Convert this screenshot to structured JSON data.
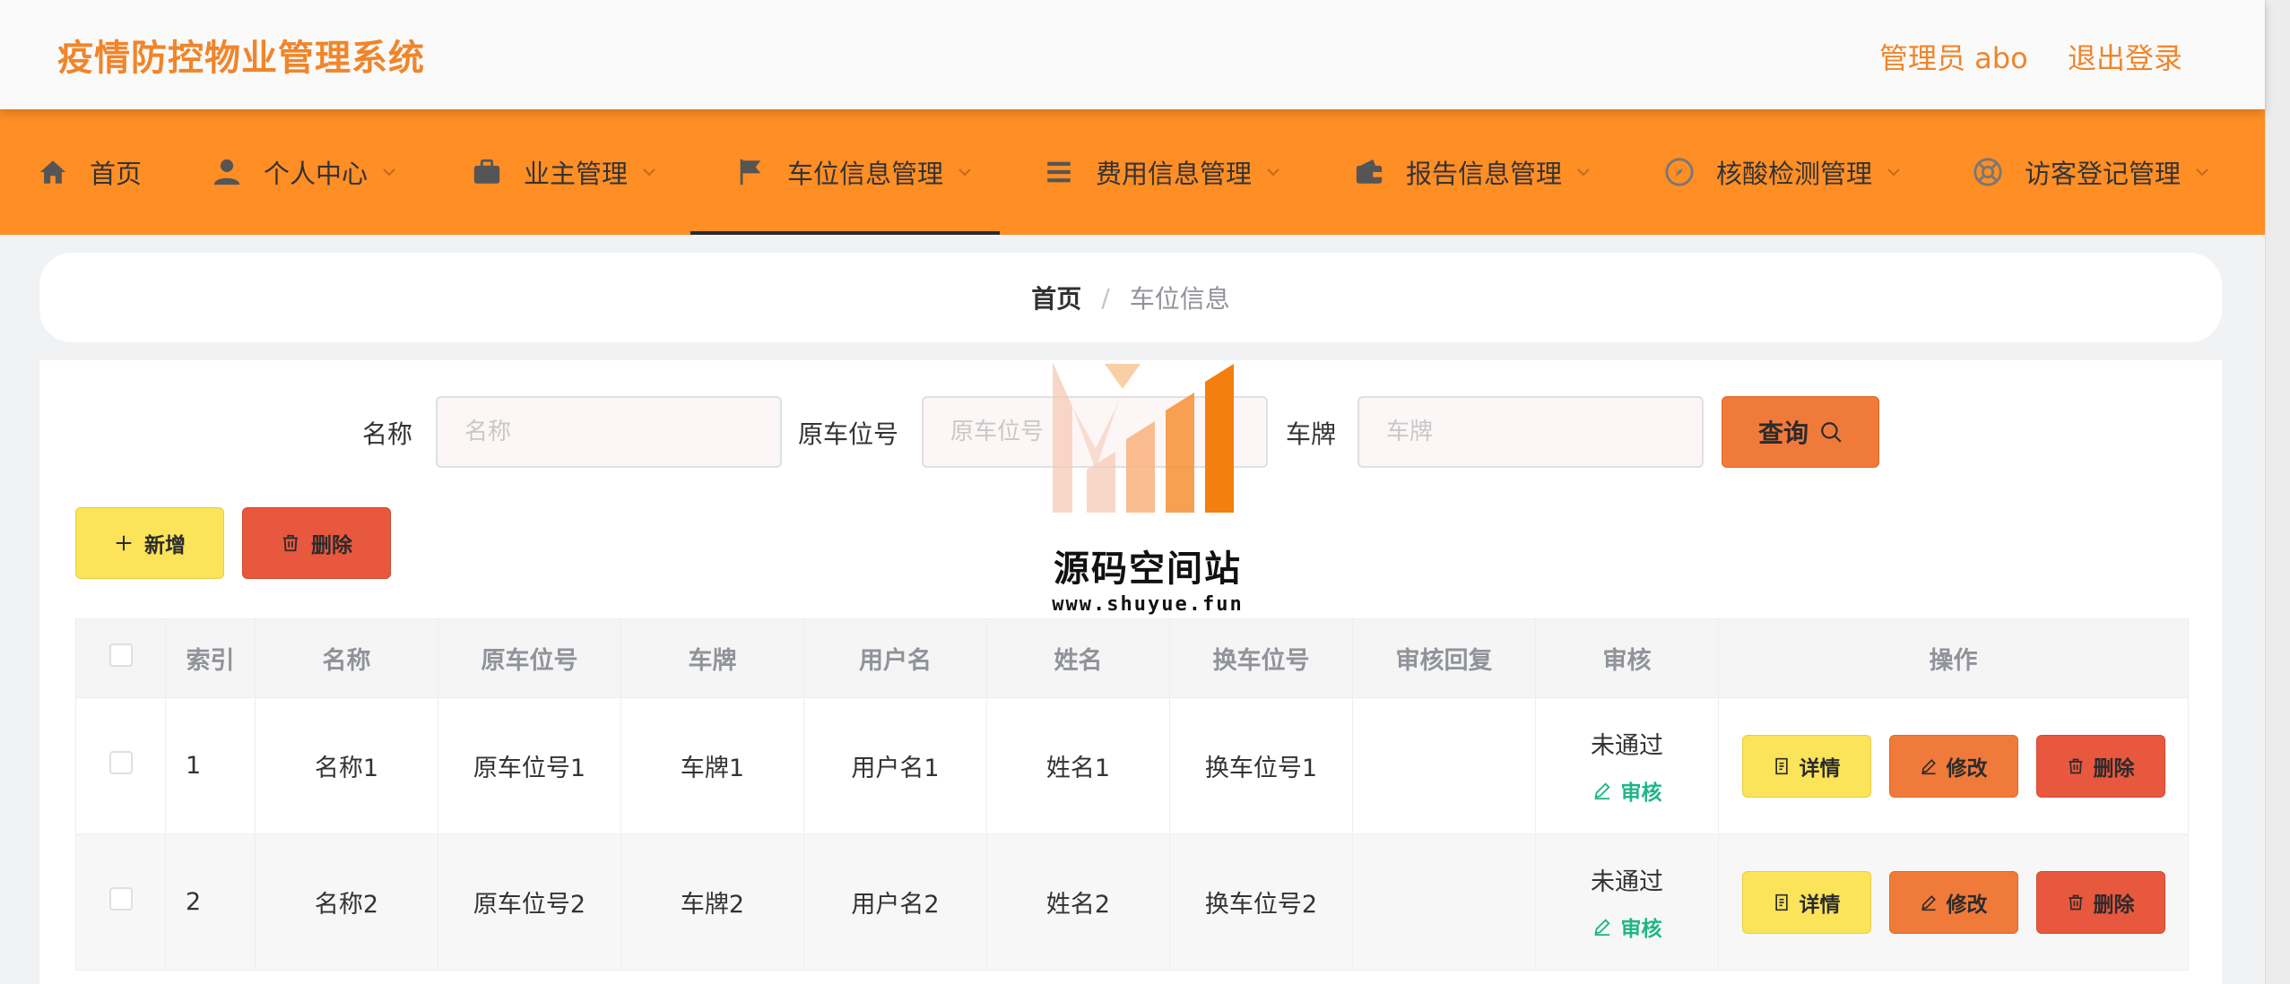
{
  "header": {
    "app_title": "疫情防控物业管理系统",
    "user_role": "管理员 abo",
    "logout_label": "退出登录"
  },
  "nav": {
    "items": [
      {
        "label": "首页",
        "icon": "home-icon",
        "has_dropdown": false
      },
      {
        "label": "个人中心",
        "icon": "user-icon",
        "has_dropdown": true
      },
      {
        "label": "业主管理",
        "icon": "briefcase-icon",
        "has_dropdown": true
      },
      {
        "label": "车位信息管理",
        "icon": "flag-icon",
        "has_dropdown": true,
        "active": true
      },
      {
        "label": "费用信息管理",
        "icon": "list-icon",
        "has_dropdown": true
      },
      {
        "label": "报告信息管理",
        "icon": "wallet-icon",
        "has_dropdown": true
      },
      {
        "label": "核酸检测管理",
        "icon": "compass-icon",
        "has_dropdown": true
      },
      {
        "label": "访客登记管理",
        "icon": "help-icon",
        "has_dropdown": true
      }
    ]
  },
  "breadcrumb": {
    "home": "首页",
    "separator": "/",
    "current": "车位信息"
  },
  "search": {
    "name_label": "名称",
    "name_placeholder": "名称",
    "orig_label": "原车位号",
    "orig_placeholder": "原车位号",
    "plate_label": "车牌",
    "plate_placeholder": "车牌",
    "query_label": "查询"
  },
  "actions": {
    "add_label": "新增",
    "delete_label": "删除"
  },
  "table": {
    "columns": [
      "索引",
      "名称",
      "原车位号",
      "车牌",
      "用户名",
      "姓名",
      "换车位号",
      "审核回复",
      "审核",
      "操作"
    ],
    "rows": [
      {
        "index": "1",
        "name": "名称1",
        "orig": "原车位号1",
        "plate": "车牌1",
        "username": "用户名1",
        "realname": "姓名1",
        "new_slot": "换车位号1",
        "reply": "",
        "status": "未通过",
        "audit_label": "审核"
      },
      {
        "index": "2",
        "name": "名称2",
        "orig": "原车位号2",
        "plate": "车牌2",
        "username": "用户名2",
        "realname": "姓名2",
        "new_slot": "换车位号2",
        "reply": "",
        "status": "未通过",
        "audit_label": "审核"
      }
    ],
    "op_labels": {
      "detail": "详情",
      "edit": "修改",
      "delete": "删除"
    }
  },
  "watermark": {
    "title": "源码空间站",
    "url": "www.shuyue.fun"
  },
  "colors": {
    "brand_orange": "#f0852a",
    "nav_bg": "#ff8e25",
    "btn_yellow": "#fbe35a",
    "btn_orange": "#f07a3a",
    "btn_red": "#e8583e",
    "audit_green": "#20b487"
  }
}
